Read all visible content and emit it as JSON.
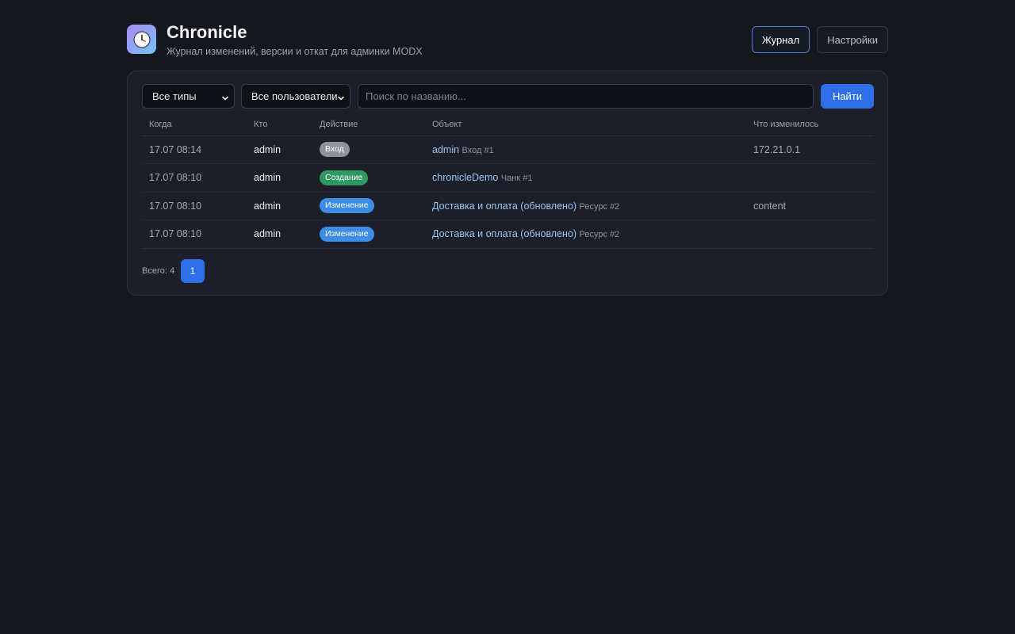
{
  "app": {
    "title": "Chronicle",
    "subtitle": "Журнал изменений, версии и откат для админки MODX",
    "logo_icon": "clock-icon"
  },
  "nav": {
    "journal_label": "Журнал",
    "settings_label": "Настройки",
    "active": "journal"
  },
  "filters": {
    "type_select": "Все типы",
    "user_select": "Все пользователи",
    "search_placeholder": "Поиск по названию...",
    "search_value": "",
    "find_label": "Найти"
  },
  "table": {
    "headers": {
      "when": "Когда",
      "who": "Кто",
      "action": "Действие",
      "object": "Объект",
      "changed": "Что изменилось"
    },
    "rows": [
      {
        "when": "17.07 08:14",
        "who": "admin",
        "action": "Вход",
        "action_color": "#8d929c",
        "object_name": "admin",
        "object_meta": "Вход #1",
        "changed": "172.21.0.1"
      },
      {
        "when": "17.07 08:10",
        "who": "admin",
        "action": "Создание",
        "action_color": "#2e9a62",
        "object_name": "chronicleDemo",
        "object_meta": "Чанк #1",
        "changed": ""
      },
      {
        "when": "17.07 08:10",
        "who": "admin",
        "action": "Изменение",
        "action_color": "#3d8ce8",
        "object_name": "Доставка и оплата (обновлено)",
        "object_meta": "Ресурс #2",
        "changed": "content"
      },
      {
        "when": "17.07 08:10",
        "who": "admin",
        "action": "Изменение",
        "action_color": "#3d8ce8",
        "object_name": "Доставка и оплата (обновлено)",
        "object_meta": "Ресурс #2",
        "changed": ""
      }
    ]
  },
  "footer": {
    "total": "Всего: 4",
    "current_page": "1"
  },
  "colors": {
    "accent": "#2f6ee8",
    "background": "#15171c",
    "panel": "#1c1f27"
  }
}
